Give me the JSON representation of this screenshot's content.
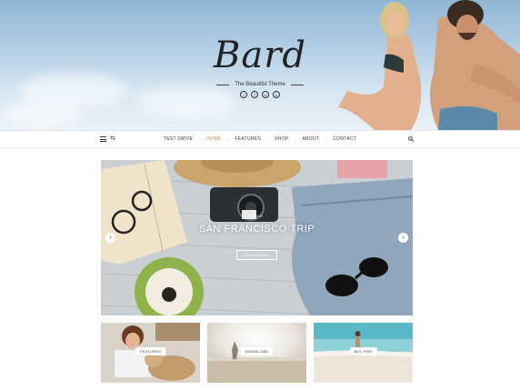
{
  "header": {
    "site_title": "Bard",
    "tagline": "The Beautiful Theme",
    "social_icons": [
      "facebook-icon",
      "twitter-icon",
      "instagram-icon",
      "pinterest-icon"
    ],
    "social_glyphs": [
      "f",
      "t",
      "in",
      "p"
    ]
  },
  "nav": {
    "items": [
      {
        "label": "TEST DRIVE",
        "active": false
      },
      {
        "label": "HOME",
        "active": true
      },
      {
        "label": "FEATURES",
        "active": false
      },
      {
        "label": "SHOP",
        "active": false
      },
      {
        "label": "ABOUT",
        "active": false
      },
      {
        "label": "CONTACT",
        "active": false
      }
    ],
    "accent_color": "#b38a4a"
  },
  "hero": {
    "category": "FOOD",
    "title": "SAN FRANCISCO TRIP",
    "button_label": "READ MORE",
    "prev_glyph": "‹",
    "next_glyph": "›"
  },
  "promo": [
    {
      "label": "FEATURES"
    },
    {
      "label": "DOWNLOAD"
    },
    {
      "label": "BUY PRO"
    }
  ]
}
